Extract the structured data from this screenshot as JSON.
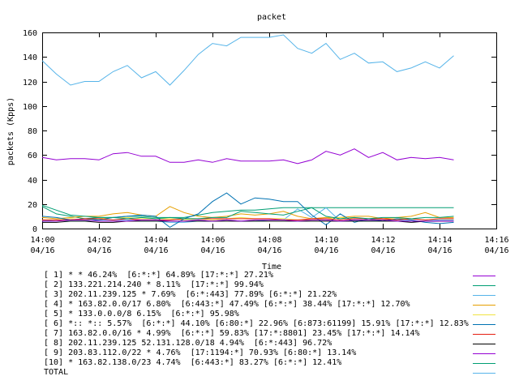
{
  "chart_data": {
    "type": "line",
    "title": "packet",
    "xlabel": "Time",
    "ylabel": "packets (Kpps)",
    "ylim": [
      0,
      160
    ],
    "y_ticks": [
      0,
      20,
      40,
      60,
      80,
      100,
      120,
      140,
      160
    ],
    "xlim": [
      0,
      16
    ],
    "x_ticks": [
      {
        "at": 0,
        "time": "14:00",
        "date": "04/16"
      },
      {
        "at": 2,
        "time": "14:02",
        "date": "04/16"
      },
      {
        "at": 4,
        "time": "14:04",
        "date": "04/16"
      },
      {
        "at": 6,
        "time": "14:06",
        "date": "04/16"
      },
      {
        "at": 8,
        "time": "14:08",
        "date": "04/16"
      },
      {
        "at": 10,
        "time": "14:10",
        "date": "04/16"
      },
      {
        "at": 12,
        "time": "14:12",
        "date": "04/16"
      },
      {
        "at": 14,
        "time": "14:14",
        "date": "04/16"
      },
      {
        "at": 16,
        "time": "14:16",
        "date": "04/16"
      }
    ],
    "x": [
      0,
      0.5,
      1,
      1.5,
      2,
      2.5,
      3,
      3.5,
      4,
      4.5,
      5,
      5.5,
      6,
      6.5,
      7,
      7.5,
      8,
      8.5,
      9,
      9.5,
      10,
      10.5,
      11,
      11.5,
      12,
      12.5,
      13,
      13.5,
      14,
      14.5
    ],
    "grid": false,
    "legend_position": "bottom",
    "series": [
      {
        "name": "[ 1] * * 46.24%  [6:*:*] 64.89% [17:*:*] 27.21%",
        "color": "#9400d3",
        "values": [
          58,
          56,
          57,
          57,
          56,
          61,
          62,
          59,
          59,
          54,
          54,
          56,
          54,
          57,
          55,
          55,
          55,
          56,
          53,
          56,
          63,
          60,
          65,
          58,
          62,
          56,
          58,
          57,
          58,
          56
        ]
      },
      {
        "name": "[ 2] 133.221.214.240 * 8.11%  [17:*:*] 99.94%",
        "color": "#009e73",
        "values": [
          18,
          12,
          10,
          8,
          9,
          9,
          10,
          10,
          9,
          9,
          9,
          11,
          13,
          14,
          15,
          15,
          16,
          17,
          17,
          17,
          17,
          17,
          17,
          17,
          17,
          17,
          17,
          17,
          17,
          17
        ]
      },
      {
        "name": "[ 3] 202.11.239.125 * 7.69%  [6:*:443] 77.89% [6:*:*] 21.22%",
        "color": "#56b4e9",
        "values": [
          6,
          7,
          6,
          6,
          7,
          7,
          7,
          6,
          6,
          5,
          5,
          6,
          6,
          7,
          6,
          6,
          7,
          7,
          16,
          9,
          17,
          6,
          7,
          6,
          7,
          7,
          6,
          6,
          7,
          7
        ]
      },
      {
        "name": "[ 4] * 163.82.0.0/17 6.80%  [6:443:*] 47.49% [6:*:*] 38.44% [17:*:*] 12.70%",
        "color": "#e69f00",
        "values": [
          9,
          8,
          9,
          10,
          10,
          12,
          13,
          11,
          10,
          18,
          13,
          10,
          9,
          10,
          12,
          11,
          12,
          14,
          10,
          8,
          9,
          9,
          10,
          10,
          8,
          9,
          10,
          13,
          9,
          9
        ]
      },
      {
        "name": "[ 5] * 133.0.0.0/8 6.15%  [6:*:*] 95.98%",
        "color": "#f0e442",
        "values": [
          7,
          7,
          8,
          7,
          8,
          9,
          9,
          8,
          8,
          8,
          7,
          8,
          7,
          8,
          9,
          8,
          8,
          8,
          7,
          7,
          8,
          9,
          8,
          8,
          7,
          8,
          8,
          7,
          8,
          8
        ]
      },
      {
        "name": "[ 6] *:: *:: 5.57%  [6:*:*] 44.10% [6:80:*] 22.96% [6:873:61199] 15.91% [17:*:*] 12.83%",
        "color": "#0072b2",
        "values": [
          10,
          9,
          7,
          8,
          7,
          9,
          10,
          11,
          10,
          1,
          8,
          12,
          22,
          29,
          20,
          25,
          24,
          22,
          22,
          11,
          3,
          12,
          5,
          8,
          6,
          8,
          7,
          5,
          4,
          5
        ]
      },
      {
        "name": "[ 7] 163.82.0.0/16 * 4.99%  [6:*:*] 59.83% [17:*:8801] 23.45% [17:*:*] 14.14%",
        "color": "#e51e10",
        "values": [
          7,
          7,
          7,
          8,
          8,
          7,
          8,
          7,
          7,
          7,
          8,
          8,
          8,
          8,
          8,
          8,
          8,
          7,
          7,
          8,
          8,
          7,
          8,
          8,
          8,
          7,
          8,
          7,
          8,
          8
        ]
      },
      {
        "name": "[ 8] 202.11.239.125 52.131.128.0/18 4.94%  [6:*:443] 96.72%",
        "color": "#000000",
        "values": [
          5,
          5,
          6,
          6,
          5,
          5,
          6,
          6,
          6,
          6,
          6,
          6,
          6,
          6,
          6,
          6,
          6,
          6,
          6,
          6,
          6,
          6,
          6,
          6,
          6,
          6,
          5,
          6,
          6,
          6
        ]
      },
      {
        "name": "[ 9] 203.83.112.0/22 * 4.76%  [17:1194:*] 70.93% [6:80:*] 13.14%",
        "color": "#9400d3",
        "values": [
          6,
          6,
          7,
          7,
          6,
          6,
          6,
          7,
          7,
          6,
          6,
          7,
          6,
          7,
          6,
          7,
          7,
          7,
          6,
          7,
          7,
          6,
          7,
          7,
          7,
          6,
          6,
          6,
          6,
          6
        ]
      },
      {
        "name": "[10] * 163.82.138.0/23 4.74%  [6:443:*] 83.27% [6:*:*] 12.41%",
        "color": "#009e73",
        "values": [
          19,
          15,
          11,
          10,
          9,
          9,
          8,
          9,
          8,
          9,
          8,
          8,
          9,
          9,
          14,
          13,
          12,
          11,
          14,
          17,
          10,
          8,
          9,
          8,
          9,
          9,
          8,
          9,
          9,
          10
        ]
      },
      {
        "name": "TOTAL",
        "color": "#56b4e9",
        "values": [
          137,
          126,
          117,
          120,
          120,
          128,
          133,
          123,
          128,
          117,
          129,
          142,
          151,
          149,
          156,
          156,
          156,
          158,
          147,
          143,
          151,
          138,
          143,
          135,
          136,
          128,
          131,
          136,
          131,
          141
        ]
      }
    ]
  }
}
